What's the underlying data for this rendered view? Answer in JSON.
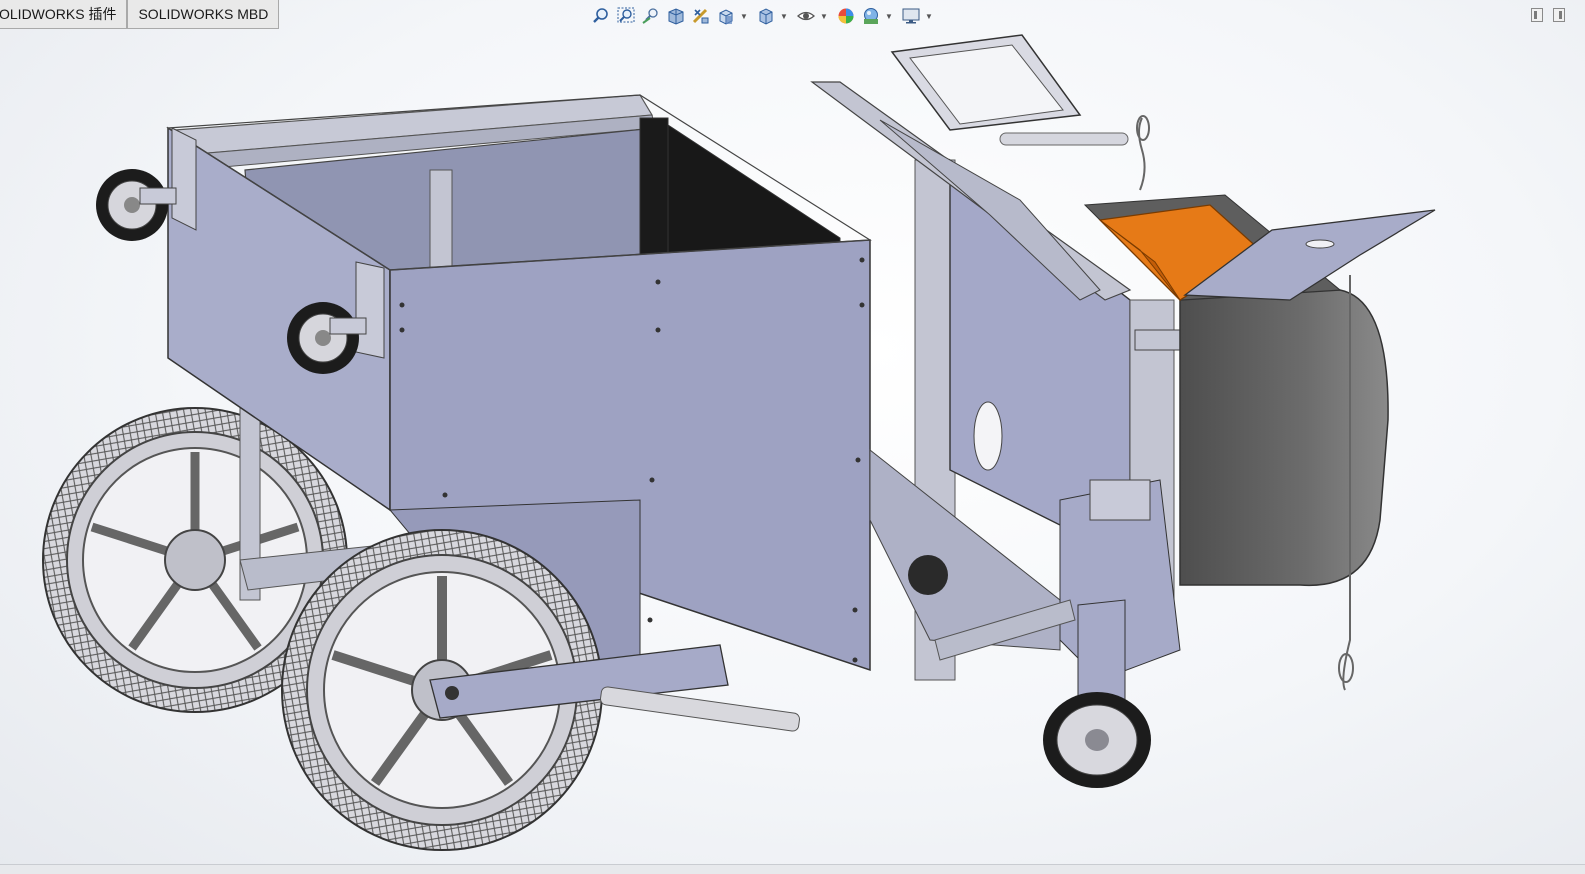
{
  "command_manager": {
    "tabs": [
      {
        "label": "OLIDWORKS 插件"
      },
      {
        "label": "SOLIDWORKS MBD"
      }
    ]
  },
  "heads_up_toolbar": {
    "buttons": [
      {
        "icon": "zoom-to-fit-icon"
      },
      {
        "icon": "zoom-to-area-icon"
      },
      {
        "icon": "previous-view-icon"
      },
      {
        "icon": "section-view-icon"
      },
      {
        "icon": "dynamic-annotation-view-icon"
      },
      {
        "icon": "view-orientation-icon",
        "dropdown": true
      },
      {
        "icon": "display-style-icon",
        "dropdown": true
      },
      {
        "icon": "hide-show-items-icon",
        "dropdown": true
      },
      {
        "icon": "edit-appearance-icon"
      },
      {
        "icon": "apply-scene-icon",
        "dropdown": true
      },
      {
        "icon": "view-settings-icon",
        "dropdown": true
      }
    ]
  },
  "colors": {
    "panel": "#a7abc9",
    "panel_dark": "#8d92b3",
    "frame": "#c7c9d6",
    "tire": "#2b2b2b",
    "hub": "#b8b8bf",
    "orange": "#e67a17",
    "grey_tray": "#6b6b6b"
  }
}
